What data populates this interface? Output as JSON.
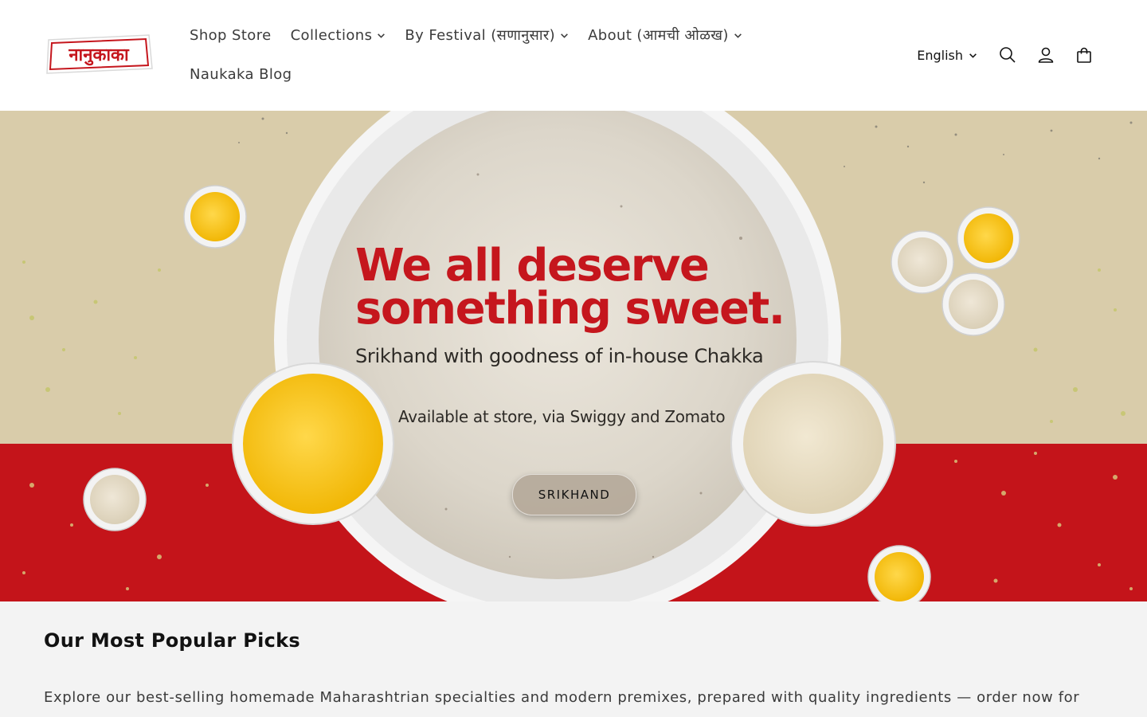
{
  "header": {
    "logo_text": "नानुकाका",
    "nav": [
      {
        "label": "Shop Store",
        "has_dropdown": false
      },
      {
        "label": "Collections",
        "has_dropdown": true
      },
      {
        "label": "By Festival (सणानुसार)",
        "has_dropdown": true
      },
      {
        "label": "About (आमची ओळख)",
        "has_dropdown": true
      },
      {
        "label": "Naukaka Blog",
        "has_dropdown": false
      }
    ],
    "language": "English",
    "icons": [
      "search-icon",
      "account-icon",
      "cart-icon"
    ]
  },
  "hero": {
    "headline_line1": "We all deserve",
    "headline_line2": "something sweet.",
    "subline": "Srikhand with goodness of in-house Chakka",
    "availability": "Available at store, via Swiggy and Zomato",
    "button_label": "SRIKHAND"
  },
  "section": {
    "title": "Our Most Popular Picks",
    "description": "Explore our best-selling homemade Maharashtrian specialties and modern premixes, prepared with quality ingredients — order now for"
  },
  "colors": {
    "brand_red": "#c5161d",
    "hero_beige": "#d9ccaa",
    "section_bg": "#f3f3f3"
  }
}
